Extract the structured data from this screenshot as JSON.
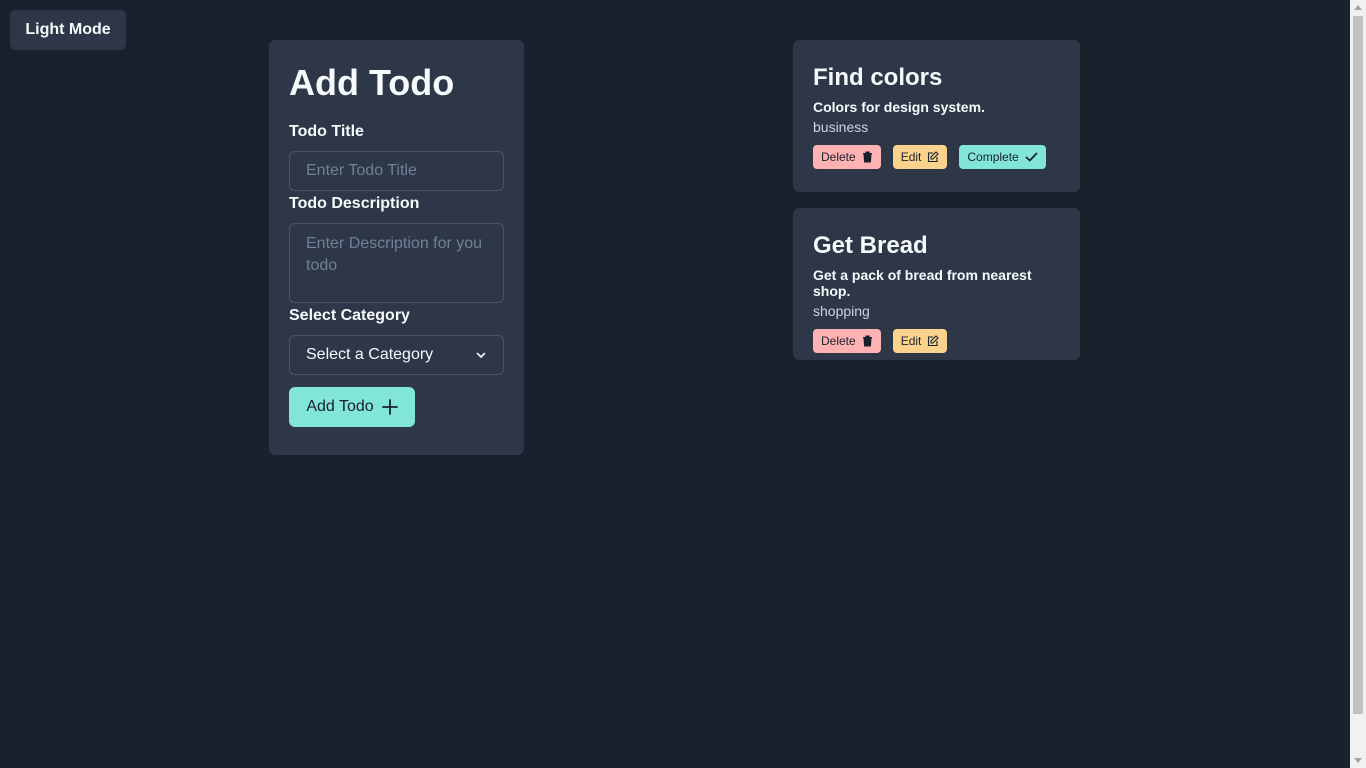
{
  "theme_toggle": {
    "label": "Light Mode"
  },
  "form": {
    "heading": "Add Todo",
    "title_label": "Todo Title",
    "title_placeholder": "Enter Todo Title",
    "title_value": "",
    "description_label": "Todo Description",
    "description_placeholder": "Enter Description for you todo",
    "description_value": "",
    "category_label": "Select Category",
    "category_selected": "Select a Category",
    "submit_label": "Add Todo"
  },
  "todos": [
    {
      "title": "Find colors",
      "description": "Colors for design system.",
      "category": "business",
      "delete_label": "Delete",
      "edit_label": "Edit",
      "complete_label": "Complete"
    },
    {
      "title": "Get Bread",
      "description": "Get a pack of bread from nearest shop.",
      "category": "shopping",
      "delete_label": "Delete",
      "edit_label": "Edit"
    }
  ],
  "colors": {
    "background": "#1a202c",
    "card": "#2d3748",
    "accent_teal": "#81e6d9",
    "delete_pink": "#feb2b2",
    "edit_orange": "#fbd38d"
  },
  "icons": {
    "submit": "plus-icon",
    "delete": "trash-icon",
    "edit": "edit-icon",
    "complete": "check-icon",
    "select": "chevron-down-icon"
  }
}
